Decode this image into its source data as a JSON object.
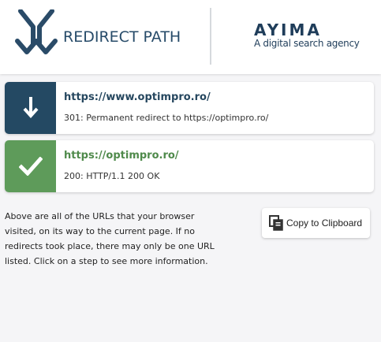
{
  "header": {
    "app_title": "REDIRECT PATH",
    "logo_icon": "redirect-path-arrows-icon",
    "brand_name": "AYIMA",
    "brand_tagline": "A digital search agency"
  },
  "steps": [
    {
      "icon": "arrow-down-icon",
      "url": "https://www.optimpro.ro/",
      "status": "301: Permanent redirect to https://optimpro.ro/",
      "color": "#244963"
    },
    {
      "icon": "checkmark-icon",
      "url": "https://optimpro.ro/",
      "status": "200: HTTP/1.1 200 OK",
      "color": "#5e9b5a"
    }
  ],
  "info_text": "Above are all of the URLs that your browser visited, on its way to the current page. If no redirects took place, there may only be one URL listed. Click on a step to see more information.",
  "copy_button": {
    "icon": "clipboard-copy-icon",
    "label": "Copy to Clipboard"
  },
  "colors": {
    "primary_navy": "#244963",
    "success_green": "#5e9b5a"
  }
}
